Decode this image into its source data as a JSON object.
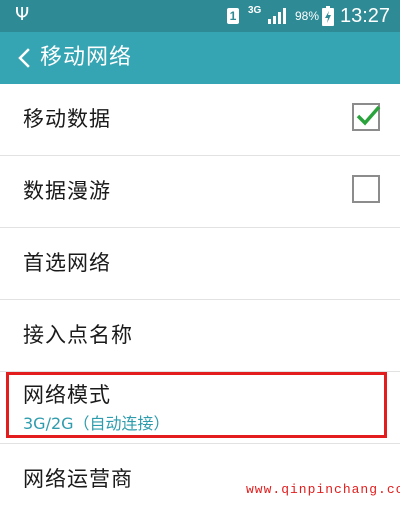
{
  "status_bar": {
    "usb_icon": "usb-icon",
    "sim_slot": "1",
    "network_type": "3G",
    "battery_percent": "98%",
    "time": "13:27"
  },
  "app_bar": {
    "title": "移动网络",
    "back_icon": "chevron-left-icon"
  },
  "settings": {
    "items": [
      {
        "label": "移动数据",
        "checked": true
      },
      {
        "label": "数据漫游",
        "checked": false
      },
      {
        "label": "首选网络"
      },
      {
        "label": "接入点名称"
      },
      {
        "label": "网络模式",
        "sublabel": "3G/2G（自动连接）"
      },
      {
        "label": "网络运营商"
      }
    ]
  },
  "colors": {
    "status_bar": "#2e8a95",
    "app_bar": "#35a4b3",
    "check_mark": "#2aa33c",
    "highlight": "#e31d1d",
    "sublabel": "#2e9cad"
  },
  "watermark": "www.qinpinchang.com"
}
